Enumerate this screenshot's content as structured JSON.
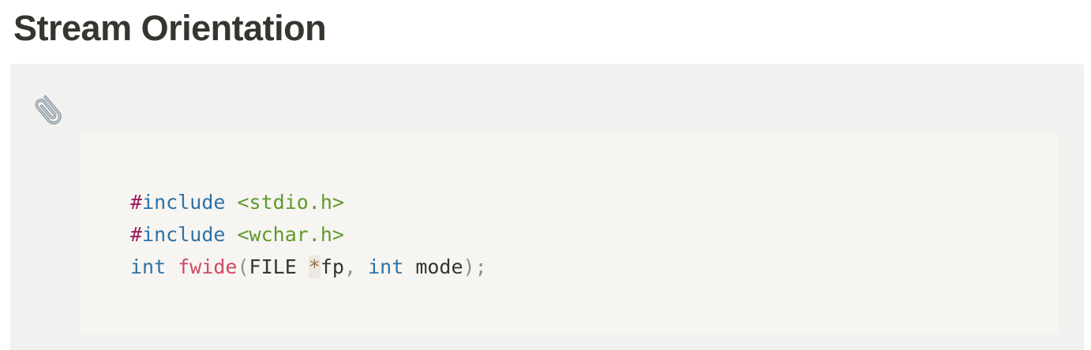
{
  "page": {
    "title": "Stream Orientation"
  },
  "callout": {
    "icon": "paperclip-icon",
    "code": {
      "lines": [
        {
          "hash": "#",
          "directive": "include",
          "space": " ",
          "header": "<stdio.h>"
        },
        {
          "hash": "#",
          "directive": "include",
          "space": " ",
          "header": "<wchar.h>"
        },
        {
          "ret_type": "int",
          "sp1": " ",
          "func": "fwide",
          "open": "(",
          "type1": "FILE ",
          "star": "*",
          "arg1": "fp",
          "comma": ",",
          "sp2": " ",
          "type2": "int",
          "arg2": " mode",
          "close": ")",
          "semi": ";"
        }
      ]
    }
  },
  "colors": {
    "heading": "#37352f",
    "callout_bg": "#f1f1ef",
    "code_bg": "#f6f5f2",
    "preprocessor": "#9c1d63",
    "keyword": "#2f72a5",
    "string": "#5f9a2a",
    "function": "#d04a62",
    "punctuation": "#8f8f8f",
    "operator": "#9a6e3a"
  }
}
